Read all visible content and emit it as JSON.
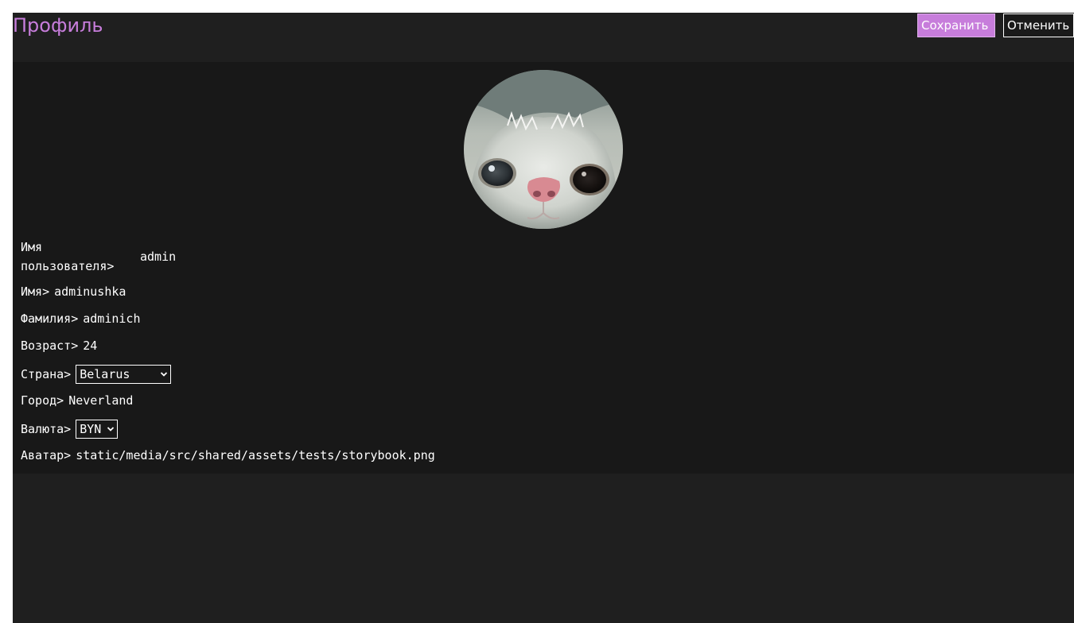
{
  "header": {
    "title": "Профиль",
    "save_label": "Сохранить",
    "cancel_label": "Отменить"
  },
  "colors": {
    "accent": "#c77ddb",
    "background": "#1f1f1f",
    "card": "#181818",
    "text": "#ffffff"
  },
  "avatar": {
    "icon": "cat-avatar-image"
  },
  "fields": {
    "username": {
      "label": "Имя пользователя>",
      "value": "admin"
    },
    "first_name": {
      "label": "Имя>",
      "value": "adminushka"
    },
    "last_name": {
      "label": "Фамилия>",
      "value": "adminich"
    },
    "age": {
      "label": "Возраст>",
      "value": "24"
    },
    "country": {
      "label": "Страна>",
      "value": "Belarus"
    },
    "city": {
      "label": "Город>",
      "value": "Neverland"
    },
    "currency": {
      "label": "Валюта>",
      "value": "BYN"
    },
    "avatar": {
      "label": "Аватар>",
      "value": "static/media/src/shared/assets/tests/storybook.png"
    }
  }
}
